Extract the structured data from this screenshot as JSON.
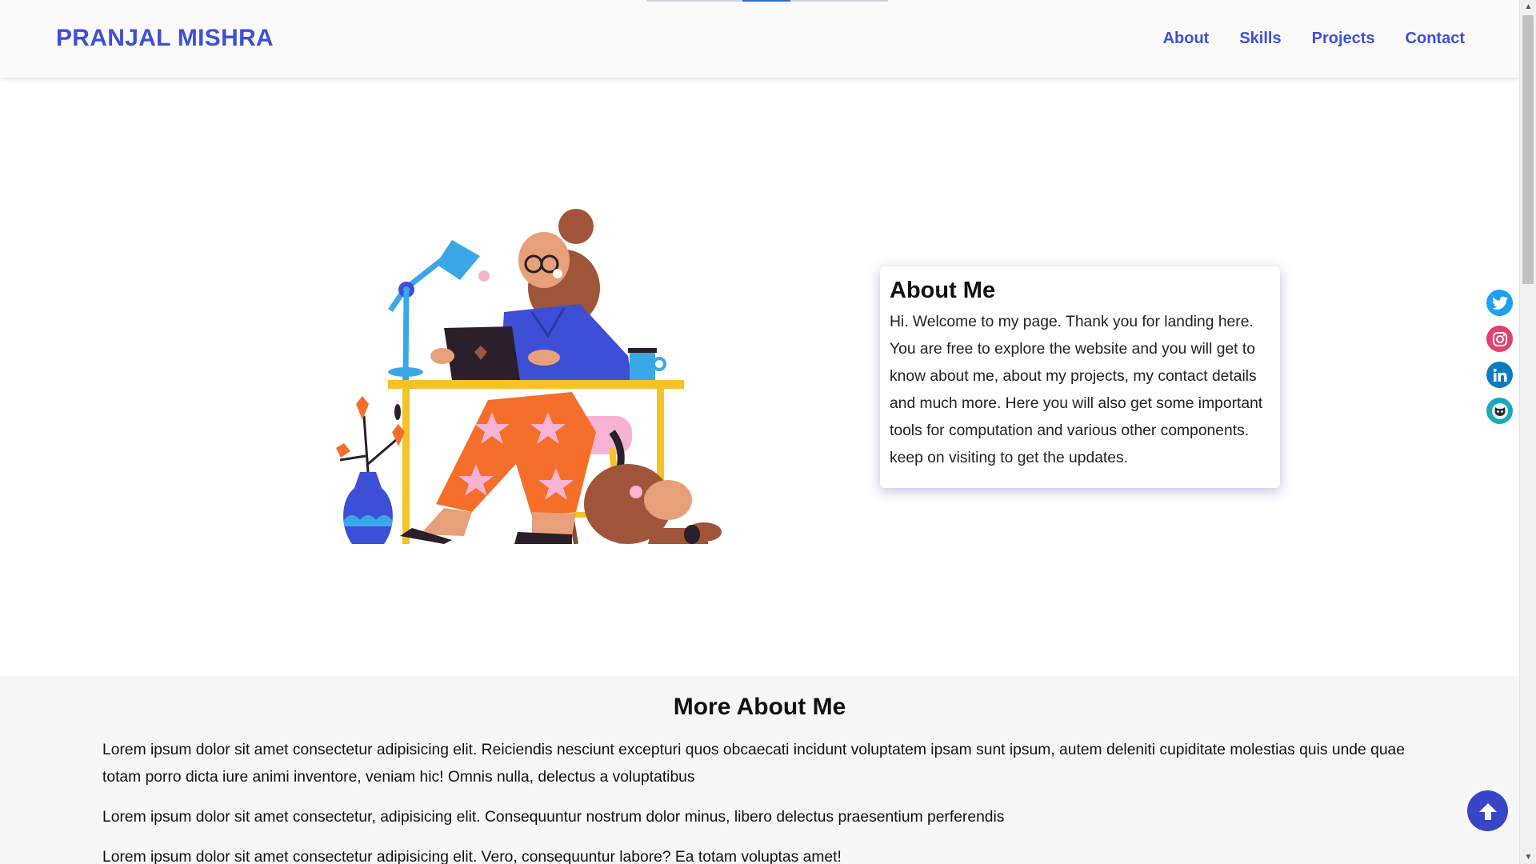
{
  "header": {
    "brand": "PRANJAL MISHRA",
    "nav": [
      "About",
      "Skills",
      "Projects",
      "Contact"
    ]
  },
  "about": {
    "title": "About Me",
    "text": "Hi. Welcome to my page. Thank you for landing here. You are free to explore the website and you will get to know about me, about my projects, my contact details and much more. Here you will also get some important tools for computation and various other components. keep on visiting to get the updates."
  },
  "more": {
    "title": "More About Me",
    "paragraphs": [
      "Lorem ipsum dolor sit amet consectetur adipisicing elit. Reiciendis nesciunt excepturi quos obcaecati incidunt voluptatem ipsam sunt ipsum, autem deleniti cupiditate molestias quis unde quae totam porro dicta iure animi inventore, veniam hic! Omnis nulla, delectus a voluptatibus",
      "Lorem ipsum dolor sit amet consectetur, adipisicing elit. Consequuntur nostrum dolor minus, libero delectus praesentium perferendis",
      "Lorem ipsum dolor sit amet consectetur adipisicing elit. Vero, consequuntur labore? Ea totam voluptas amet!"
    ]
  },
  "social": [
    "twitter-icon",
    "instagram-icon",
    "linkedin-icon",
    "github-icon"
  ],
  "colors": {
    "accent": "#3f4fd6",
    "to_top": "#3745c9"
  }
}
